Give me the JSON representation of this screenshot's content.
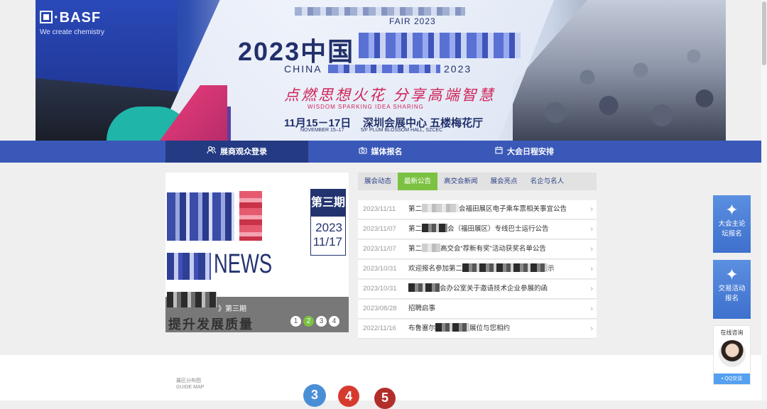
{
  "banner": {
    "brand": "BASF",
    "brand_tagline": "We create chemistry",
    "fair_year": "FAIR 2023",
    "title_prefix": "2023中国",
    "china_label": "CHINA",
    "china_year": "2023",
    "slogan": "点燃思想火花  分享高端智慧",
    "slogan_en": "WISDOM SPARKING  IDEA SHARING",
    "dates_cn": "11月15－17日",
    "dates_en": "NOVEMBER 15–17",
    "venue_cn": "深圳会展中心 五楼梅花厅",
    "venue_en": "5/F PLUM BLOSSOM HALL, SZCEC"
  },
  "nav": {
    "items": [
      {
        "label": "展商观众登录",
        "icon": "users-icon"
      },
      {
        "label": "媒体报名",
        "icon": "camera-icon"
      },
      {
        "label": "大会日程安排",
        "icon": "calendar-icon"
      }
    ]
  },
  "slider": {
    "issue_label": "第三期",
    "issue_year": "2023",
    "issue_date": "11/17",
    "news_word": "NEWS",
    "caption": "》第三期",
    "caption_big": "提升发展质量",
    "pages": [
      "1",
      "2",
      "3",
      "4"
    ],
    "active_page": 2
  },
  "tabs": [
    "展会动态",
    "最新公告",
    "高交会新闻",
    "展会亮点",
    "名企与名人"
  ],
  "active_tab": 1,
  "news": [
    {
      "date": "2023/11/11",
      "pre": "第二",
      "post": "会福田展区电子乘车票相关事宜公告"
    },
    {
      "date": "2023/11/07",
      "pre": "第二",
      "post": "会（福田展区）专线巴士运行公告"
    },
    {
      "date": "2023/11/07",
      "pre": "第二",
      "post": "高交会“荐新有奖”活动获奖名单公告"
    },
    {
      "date": "2023/10/31",
      "pre": "欢迎报名参加第二",
      "post": "示"
    },
    {
      "date": "2023/10/31",
      "pre": "",
      "post": "会办公室关于邀请技术企业参展的函"
    },
    {
      "date": "2023/08/28",
      "pre": "招聘启事",
      "post": ""
    },
    {
      "date": "2022/11/16",
      "pre": "布鲁塞尔",
      "post": "展位与您相约"
    }
  ],
  "guide": {
    "label_cn": "展区分布图",
    "label_en": "GUIDE MAP",
    "circles": [
      "3",
      "4",
      "5"
    ]
  },
  "side": {
    "forum": "大会主论坛报名",
    "trade": "交易活动报名",
    "consult_title": "在线咨询",
    "qq_label": "QQ交谈"
  },
  "colors": {
    "nav_blue": "#3a58b8",
    "nav_active": "#243b83",
    "accent_green": "#7cc242",
    "circle_blue": "#4a8fd6",
    "circle_red": "#d63a2f",
    "circle_darkred": "#b22e2a"
  }
}
